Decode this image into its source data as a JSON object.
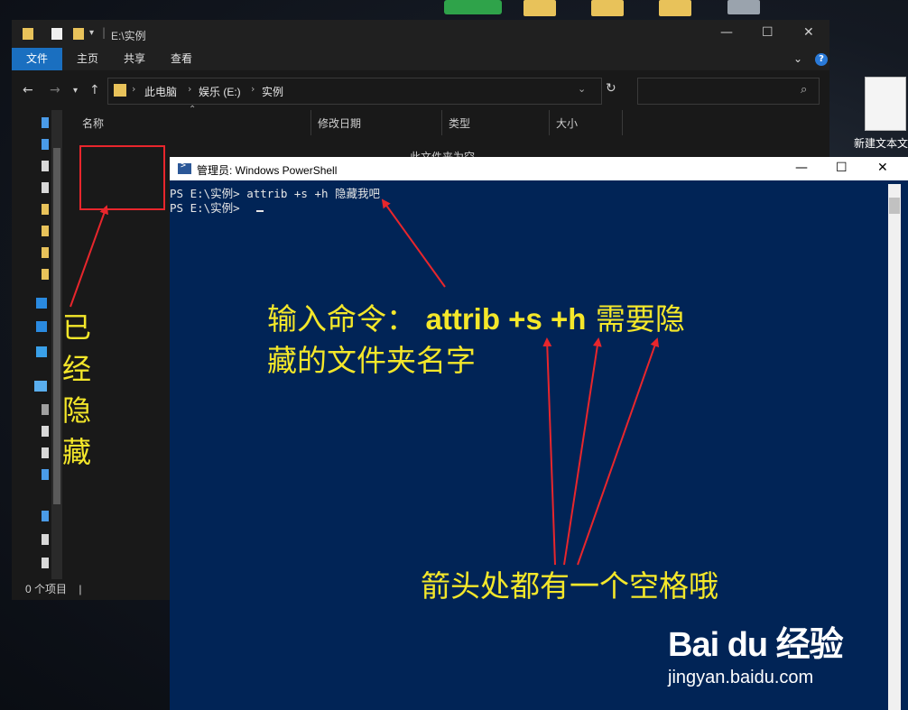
{
  "desktop": {
    "file_label": "新建文本文"
  },
  "explorer": {
    "title_path": "E:\\实例",
    "window_buttons": {
      "min": "—",
      "max": "☐",
      "close": "✕"
    },
    "ribbon_tabs": [
      "文件",
      "主页",
      "共享",
      "查看"
    ],
    "help": "?",
    "breadcrumbs": [
      "此电脑",
      "娱乐 (E:)",
      "实例"
    ],
    "columns": [
      "名称",
      "修改日期",
      "类型",
      "大小"
    ],
    "empty_text": "此文件夹为空。",
    "status": "0 个项目"
  },
  "powershell": {
    "title": "管理员: Windows PowerShell",
    "window_buttons": {
      "min": "—",
      "max": "☐",
      "close": "✕"
    },
    "lines": [
      "PS E:\\实例> attrib +s +h 隐藏我吧",
      "PS E:\\实例> "
    ]
  },
  "annotations": {
    "hidden_label": [
      "已",
      "经",
      "隐",
      "藏"
    ],
    "instruction_prefix": "输入命令：",
    "instruction_cmd": "attrib +s +h",
    "instruction_suffix": "需要隐",
    "instruction_line2": "藏的文件夹名字",
    "space_note": "箭头处都有一个空格哦"
  },
  "watermark": {
    "logo": "Bai du 经验",
    "url": "jingyan.baidu.com"
  },
  "colors": {
    "ps_bg": "#012456",
    "annotation_yellow": "#f4e72a",
    "arrow_red": "#e8262c",
    "ribbon_file_blue": "#1a6fc0"
  }
}
